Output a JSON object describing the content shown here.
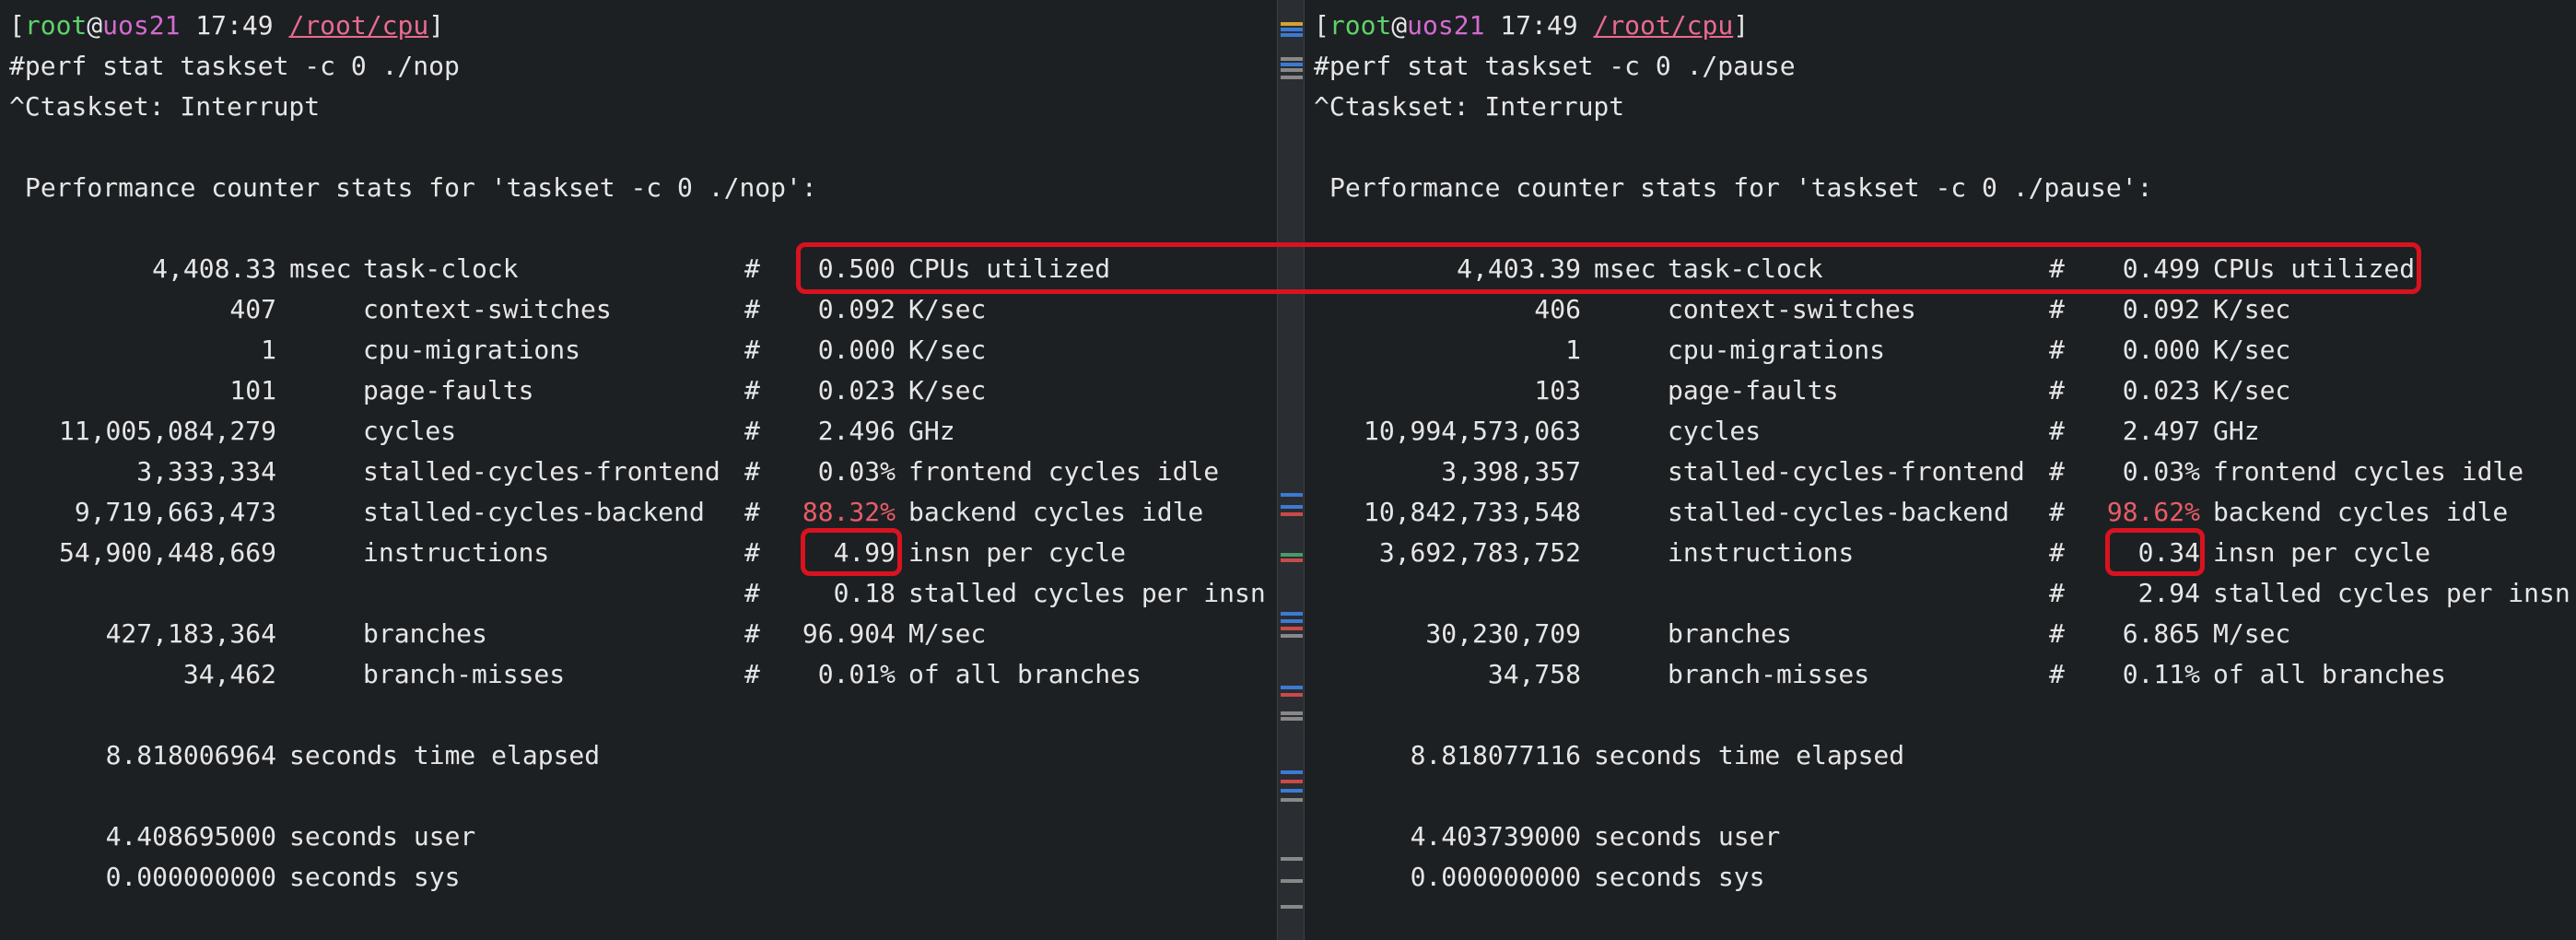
{
  "colors": {
    "background": "#1d2023",
    "user": "#5ed36b",
    "host": "#d36bd0",
    "path": "#e96b8e",
    "highlight_text": "#e85d68",
    "annotation_box": "#d8131f"
  },
  "left": {
    "prompt": {
      "open": "[",
      "user": "root",
      "at": "@",
      "host": "uos21",
      "time": " 17:49 ",
      "path": "/root/cpu",
      "close": "]"
    },
    "command": "#perf stat taskset -c 0 ./nop",
    "interrupt": "^Ctaskset: Interrupt",
    "header": "Performance counter stats for 'taskset -c 0 ./nop':",
    "rows": [
      {
        "value": "4,408.33",
        "unit": "msec",
        "event": "task-clock",
        "hash": "#",
        "metric": "0.500",
        "desc": "CPUs utilized"
      },
      {
        "value": "407",
        "unit": "",
        "event": "context-switches",
        "hash": "#",
        "metric": "0.092",
        "desc": "K/sec"
      },
      {
        "value": "1",
        "unit": "",
        "event": "cpu-migrations",
        "hash": "#",
        "metric": "0.000",
        "desc": "K/sec"
      },
      {
        "value": "101",
        "unit": "",
        "event": "page-faults",
        "hash": "#",
        "metric": "0.023",
        "desc": "K/sec"
      },
      {
        "value": "11,005,084,279",
        "unit": "",
        "event": "cycles",
        "hash": "#",
        "metric": "2.496",
        "desc": "GHz"
      },
      {
        "value": "3,333,334",
        "unit": "",
        "event": "stalled-cycles-frontend",
        "hash": "#",
        "metric": "0.03%",
        "desc": "frontend cycles idle"
      },
      {
        "value": "9,719,663,473",
        "unit": "",
        "event": "stalled-cycles-backend",
        "hash": "#",
        "metric": "88.32%",
        "desc": "backend cycles idle"
      },
      {
        "value": "54,900,448,669",
        "unit": "",
        "event": "instructions",
        "hash": "#",
        "metric": "4.99",
        "desc": "insn per cycle"
      },
      {
        "value": "",
        "unit": "",
        "event": "",
        "hash": "#",
        "metric": "0.18",
        "desc": "stalled cycles per insn"
      },
      {
        "value": "427,183,364",
        "unit": "",
        "event": "branches",
        "hash": "#",
        "metric": "96.904",
        "desc": "M/sec"
      },
      {
        "value": "34,462",
        "unit": "",
        "event": "branch-misses",
        "hash": "#",
        "metric": "0.01%",
        "desc": "of all branches"
      }
    ],
    "elapsed": {
      "value": "8.818006964",
      "label": "seconds time elapsed"
    },
    "user": {
      "value": "4.408695000",
      "label": "seconds user"
    },
    "sys": {
      "value": "0.000000000",
      "label": "seconds sys"
    }
  },
  "right": {
    "prompt": {
      "open": "[",
      "user": "root",
      "at": "@",
      "host": "uos21",
      "time": " 17:49 ",
      "path": "/root/cpu",
      "close": "]"
    },
    "command": "#perf stat taskset -c 0 ./pause",
    "interrupt": "^Ctaskset: Interrupt",
    "header": "Performance counter stats for 'taskset -c 0 ./pause':",
    "rows": [
      {
        "value": "4,403.39",
        "unit": "msec",
        "event": "task-clock",
        "hash": "#",
        "metric": "0.499",
        "desc": "CPUs utilized"
      },
      {
        "value": "406",
        "unit": "",
        "event": "context-switches",
        "hash": "#",
        "metric": "0.092",
        "desc": "K/sec"
      },
      {
        "value": "1",
        "unit": "",
        "event": "cpu-migrations",
        "hash": "#",
        "metric": "0.000",
        "desc": "K/sec"
      },
      {
        "value": "103",
        "unit": "",
        "event": "page-faults",
        "hash": "#",
        "metric": "0.023",
        "desc": "K/sec"
      },
      {
        "value": "10,994,573,063",
        "unit": "",
        "event": "cycles",
        "hash": "#",
        "metric": "2.497",
        "desc": "GHz"
      },
      {
        "value": "3,398,357",
        "unit": "",
        "event": "stalled-cycles-frontend",
        "hash": "#",
        "metric": "0.03%",
        "desc": "frontend cycles idle"
      },
      {
        "value": "10,842,733,548",
        "unit": "",
        "event": "stalled-cycles-backend",
        "hash": "#",
        "metric": "98.62%",
        "desc": "backend cycles idle"
      },
      {
        "value": "3,692,783,752",
        "unit": "",
        "event": "instructions",
        "hash": "#",
        "metric": "0.34",
        "desc": "insn per cycle"
      },
      {
        "value": "",
        "unit": "",
        "event": "",
        "hash": "#",
        "metric": "2.94",
        "desc": "stalled cycles per insn"
      },
      {
        "value": "30,230,709",
        "unit": "",
        "event": "branches",
        "hash": "#",
        "metric": "6.865",
        "desc": "M/sec"
      },
      {
        "value": "34,758",
        "unit": "",
        "event": "branch-misses",
        "hash": "#",
        "metric": "0.11%",
        "desc": "of all branches"
      }
    ],
    "elapsed": {
      "value": "8.818077116",
      "label": "seconds time elapsed"
    },
    "user": {
      "value": "4.403739000",
      "label": "seconds user"
    },
    "sys": {
      "value": "0.000000000",
      "label": "seconds sys"
    }
  }
}
